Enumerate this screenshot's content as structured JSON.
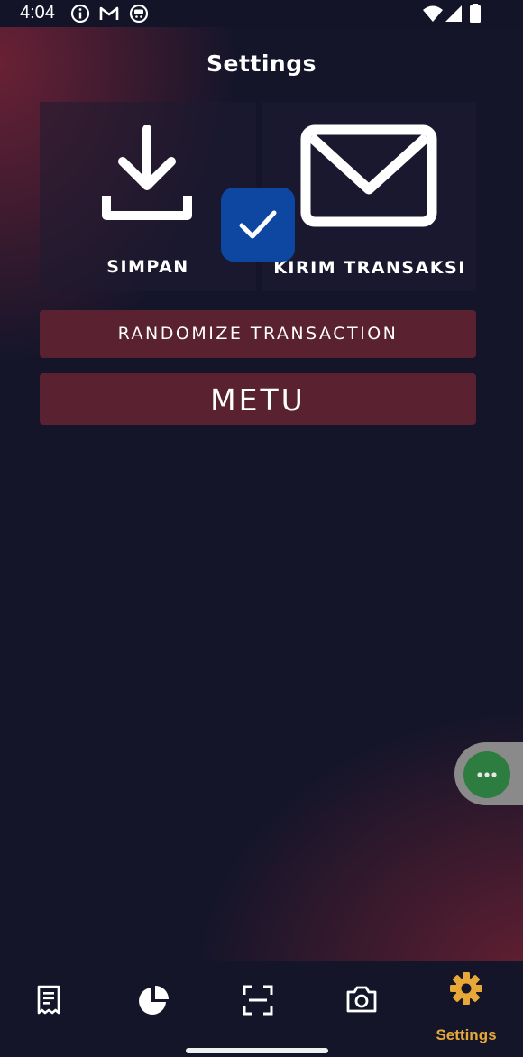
{
  "status_bar": {
    "time": "4:04",
    "icons": [
      "info-icon",
      "gmail-icon",
      "app-icon",
      "wifi-icon",
      "signal-icon",
      "battery-icon"
    ]
  },
  "header": {
    "title": "Settings"
  },
  "actions": {
    "save_label": "SIMPAN",
    "send_label": "KIRIM TRANSAKSI",
    "randomize_label": "RANDOMIZE TRANSACTION",
    "metu_label": "METU"
  },
  "bottom_nav": {
    "items": [
      {
        "icon": "receipt-icon",
        "label": ""
      },
      {
        "icon": "pie-chart-icon",
        "label": ""
      },
      {
        "icon": "scan-icon",
        "label": ""
      },
      {
        "icon": "camera-icon",
        "label": ""
      },
      {
        "icon": "gear-icon",
        "label": "Settings",
        "active": true
      }
    ],
    "active_color": "#e8a838"
  },
  "colors": {
    "background": "#15152a",
    "button": "#5a2130",
    "check_badge": "#0d47a1",
    "floating_bubble": "#2e7d40"
  }
}
